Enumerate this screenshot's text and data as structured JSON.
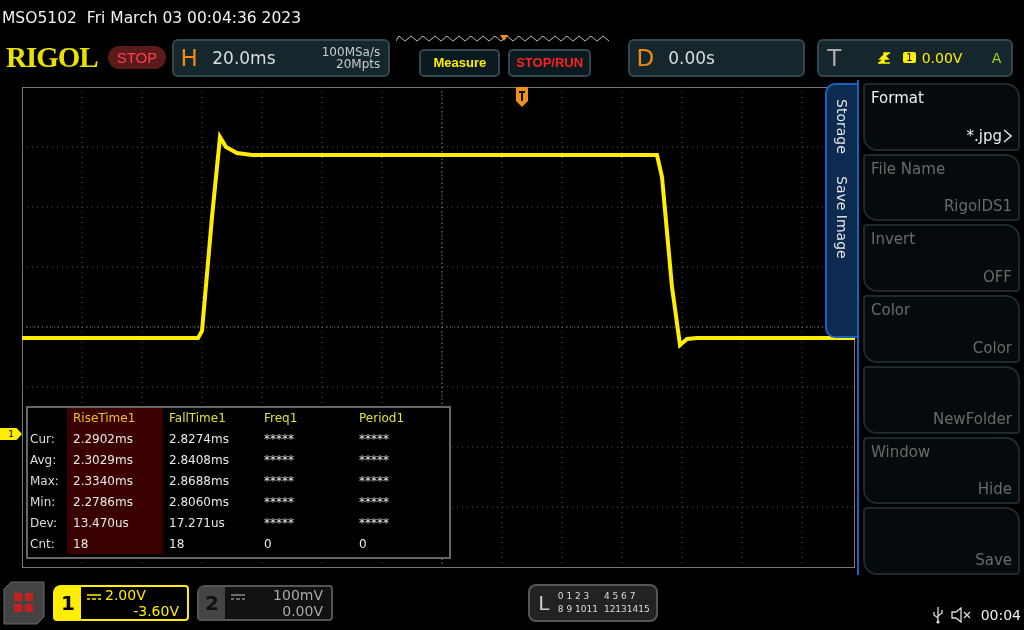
{
  "status_line": {
    "model": "MSO5102",
    "datetime": "Fri March 03 00:04:36 2023"
  },
  "toolbar": {
    "logo": "RIGOL",
    "run_state": "STOP",
    "horizontal": {
      "label": "H",
      "scale": "20.0ms",
      "sample_rate": "100MSa/s",
      "memory": "20Mpts"
    },
    "measure_button": "Measure",
    "stop_run_button": "STOP/RUN",
    "delay": {
      "label": "D",
      "value": "0.00s"
    },
    "trigger": {
      "label": "T",
      "channel": "1",
      "level": "0.00V",
      "mode": "A"
    }
  },
  "channel_marker": "1",
  "measure_table": {
    "columns": [
      {
        "label": "RiseTime1",
        "selected": true
      },
      {
        "label": "FallTime1",
        "selected": false
      },
      {
        "label": "Freq1",
        "selected": false
      },
      {
        "label": "Period1",
        "selected": false
      }
    ],
    "rows": [
      {
        "label": "Cur:",
        "values": [
          "2.2902ms",
          "2.8274ms",
          "*****",
          "*****"
        ]
      },
      {
        "label": "Avg:",
        "values": [
          "2.3029ms",
          "2.8408ms",
          "*****",
          "*****"
        ]
      },
      {
        "label": "Max:",
        "values": [
          "2.3340ms",
          "2.8688ms",
          "*****",
          "*****"
        ]
      },
      {
        "label": "Min:",
        "values": [
          "2.2786ms",
          "2.8060ms",
          "*****",
          "*****"
        ]
      },
      {
        "label": "Dev:",
        "values": [
          "13.470us",
          "17.271us",
          "*****",
          "*****"
        ]
      },
      {
        "label": "Cnt:",
        "values": [
          "18",
          "18",
          "0",
          "0"
        ]
      }
    ]
  },
  "side_menu": {
    "tabs": [
      "Storage",
      "Save Image"
    ],
    "items": [
      {
        "label": "Format",
        "value": "*.jpg",
        "disabled": false,
        "kind": "submenu"
      },
      {
        "label": "File Name",
        "value": "RigolDS1",
        "disabled": true,
        "kind": "plain"
      },
      {
        "label": "Invert",
        "value": "OFF",
        "disabled": true,
        "kind": "plain"
      },
      {
        "label": "Color",
        "value": "Color",
        "disabled": true,
        "kind": "plain"
      },
      {
        "value": "NewFolder",
        "disabled": true,
        "kind": "plain"
      },
      {
        "label": "Window",
        "value": "Hide",
        "disabled": true,
        "kind": "plain"
      },
      {
        "value": "Save",
        "disabled": true,
        "kind": "plain"
      }
    ]
  },
  "channels": [
    {
      "number": "1",
      "scale": "2.00V",
      "offset": "-3.60V",
      "selected": true
    },
    {
      "number": "2",
      "scale": "100mV",
      "offset": "0.00V",
      "selected": false
    }
  ],
  "logic": {
    "label": "L",
    "bit_groups": [
      "0 1 2 3",
      "4 5 6 7",
      "8 9 1011",
      "12131415"
    ]
  },
  "status": {
    "muted": true,
    "clock": "00:04"
  }
}
